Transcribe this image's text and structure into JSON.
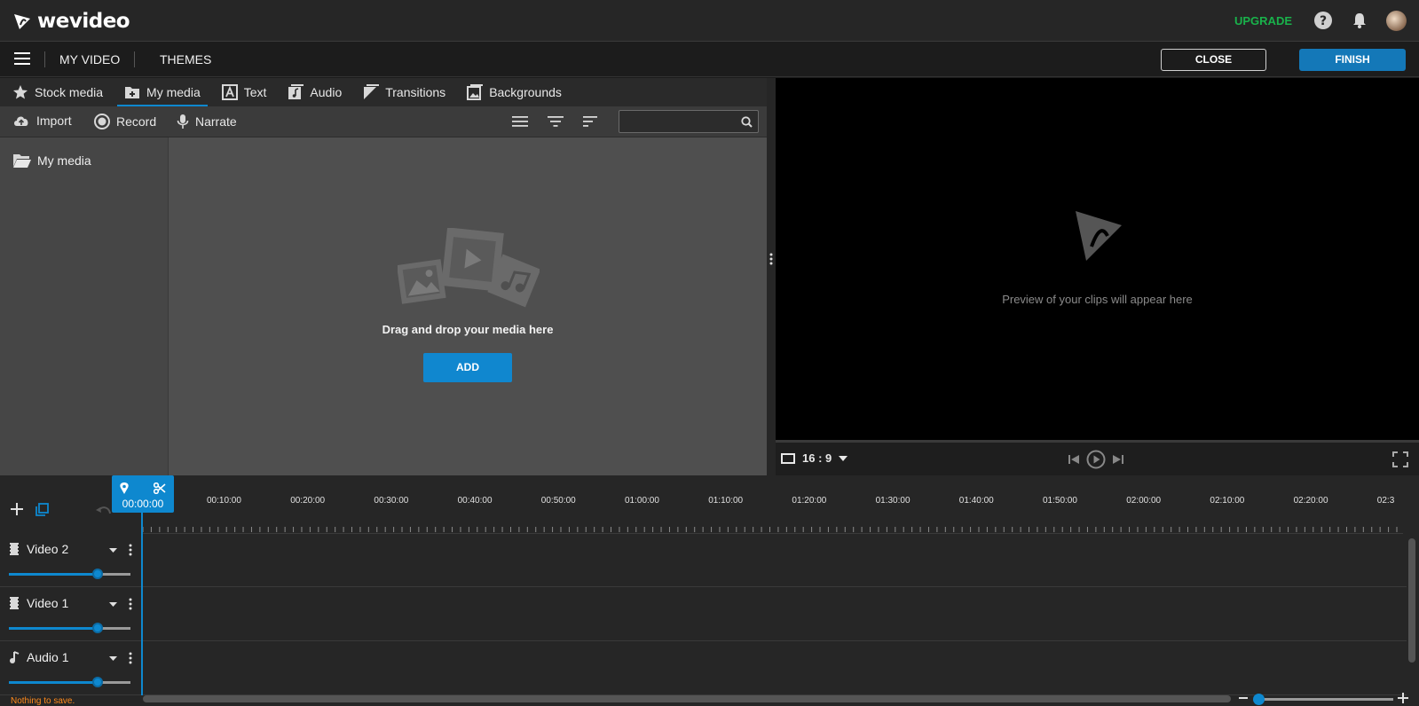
{
  "header": {
    "logo_text": "wevideo",
    "upgrade_label": "UPGRADE"
  },
  "menubar": {
    "project_title": "MY VIDEO",
    "themes_label": "THEMES",
    "close_label": "CLOSE",
    "finish_label": "FINISH"
  },
  "tabs": [
    {
      "label": "Stock media",
      "icon": "star-icon"
    },
    {
      "label": "My media",
      "icon": "folder-add-icon",
      "active": true
    },
    {
      "label": "Text",
      "icon": "text-icon"
    },
    {
      "label": "Audio",
      "icon": "audio-icon"
    },
    {
      "label": "Transitions",
      "icon": "transitions-icon"
    },
    {
      "label": "Backgrounds",
      "icon": "image-icon"
    }
  ],
  "toolbar": {
    "import_label": "Import",
    "record_label": "Record",
    "narrate_label": "Narrate",
    "search_placeholder": ""
  },
  "media": {
    "folder_label": "My media",
    "drop_text": "Drag and drop your media here",
    "add_label": "ADD"
  },
  "preview": {
    "message": "Preview of your clips will appear here",
    "aspect_ratio": "16 : 9"
  },
  "timeline": {
    "playhead_time": "00:00:00",
    "ruler_labels": [
      "00:10:00",
      "00:20:00",
      "00:30:00",
      "00:40:00",
      "00:50:00",
      "01:00:00",
      "01:10:00",
      "01:20:00",
      "01:30:00",
      "01:40:00",
      "01:50:00",
      "02:00:00",
      "02:10:00",
      "02:20:00",
      "02:3"
    ],
    "tracks": [
      {
        "name": "Video 2",
        "type": "video",
        "volume": 0.73
      },
      {
        "name": "Video 1",
        "type": "video",
        "volume": 0.73
      },
      {
        "name": "Audio 1",
        "type": "audio",
        "volume": 0.73
      }
    ],
    "status_text": "Nothing to save.",
    "zoom_level": 0.03
  },
  "colors": {
    "accent": "#0e88cf",
    "upgrade": "#19b24b",
    "status": "#ff8a1c"
  }
}
